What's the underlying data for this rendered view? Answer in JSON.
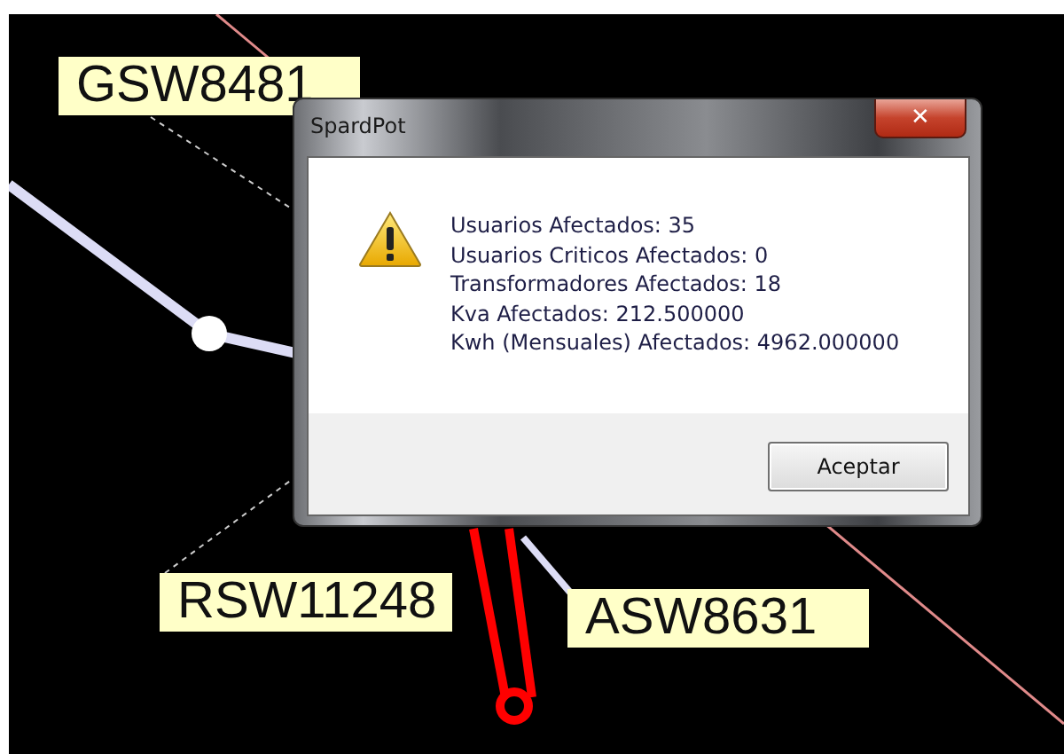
{
  "map": {
    "labels": [
      {
        "text": "GSW8481",
        "kind": "upper"
      },
      {
        "text": "RSW11248",
        "kind": "lower-left"
      },
      {
        "text": "ASW8631",
        "kind": "lower-right"
      }
    ]
  },
  "dialog": {
    "title": "SpardPot",
    "close": "✕",
    "lines": [
      "Usuarios Afectados: 35",
      "Usuarios Criticos Afectados: 0",
      "Transformadores Afectados: 18",
      "Kva Afectados: 212.500000",
      "Kwh (Mensuales) Afectados: 4962.000000"
    ],
    "button": "Aceptar"
  }
}
